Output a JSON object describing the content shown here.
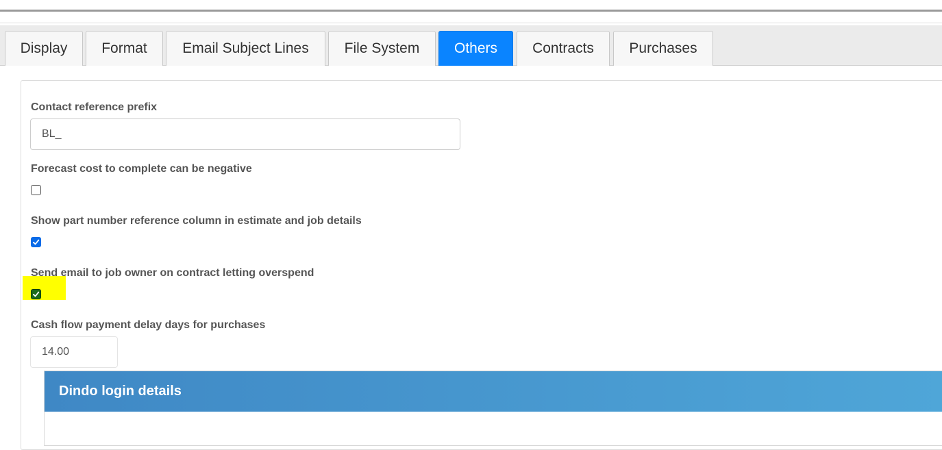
{
  "tabs": [
    {
      "label": "Display",
      "active": false
    },
    {
      "label": "Format",
      "active": false
    },
    {
      "label": "Email Subject Lines",
      "active": false
    },
    {
      "label": "File System",
      "active": false
    },
    {
      "label": "Others",
      "active": true
    },
    {
      "label": "Contracts",
      "active": false
    },
    {
      "label": "Purchases",
      "active": false
    }
  ],
  "form": {
    "contact_reference_prefix": {
      "label": "Contact reference prefix",
      "value": "BL_"
    },
    "forecast_negative": {
      "label": "Forecast cost to complete can be negative",
      "checked": false
    },
    "show_part_number": {
      "label": "Show part number reference column in estimate and job details",
      "checked": true
    },
    "send_email_overspend": {
      "label": "Send email to job owner on contract letting overspend",
      "checked": true
    },
    "cash_flow_delay": {
      "label": "Cash flow payment delay days for purchases",
      "value": "14.00"
    }
  },
  "dindo": {
    "title": "Dindo login details"
  },
  "colors": {
    "active_tab": "#0a84ff",
    "header_gradient_start": "#3f88c5",
    "header_gradient_end": "#4fa6d8",
    "highlight": "#ffff00"
  }
}
